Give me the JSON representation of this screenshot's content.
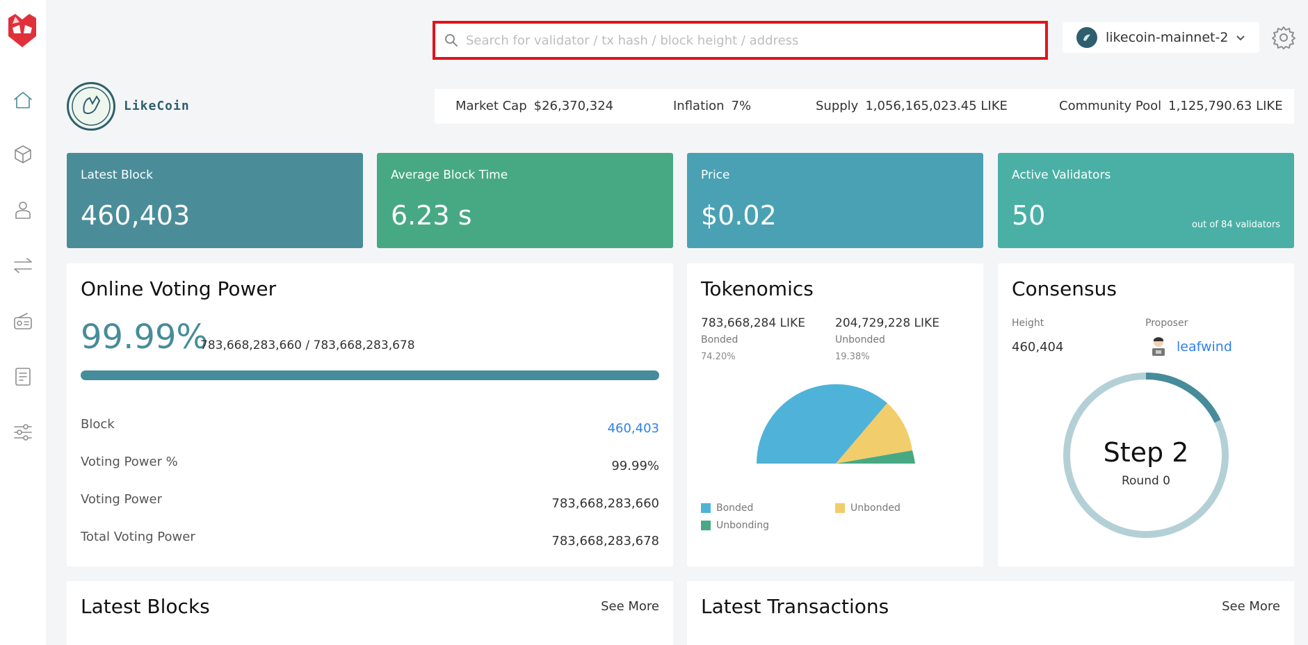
{
  "search": {
    "placeholder": "Search for validator / tx hash / block height / address"
  },
  "network": {
    "label": "likecoin-mainnet-2"
  },
  "brand": {
    "name": "LikeCoin"
  },
  "stats": {
    "market_cap_label": "Market Cap",
    "market_cap_value": "$26,370,324",
    "inflation_label": "Inflation",
    "inflation_value": "7%",
    "supply_label": "Supply",
    "supply_value": "1,056,165,023.45 LIKE",
    "pool_label": "Community Pool",
    "pool_value": "1,125,790.63 LIKE"
  },
  "cards": {
    "latest_block": {
      "title": "Latest Block",
      "value": "460,403",
      "color": "#4a8d99"
    },
    "avg_block_time": {
      "title": "Average Block Time",
      "value": "6.23 s",
      "color": "#47a983"
    },
    "price": {
      "title": "Price",
      "value": "$0.02",
      "color": "#4aa1b4"
    },
    "active_validators": {
      "title": "Active Validators",
      "value": "50",
      "sub": "out of 84 validators",
      "color": "#4ab0a6"
    }
  },
  "voting": {
    "title": "Online Voting Power",
    "percent": "99.99%",
    "fraction": "783,668,283,660 / 783,668,283,678",
    "bar_fill": 0.9999,
    "rows": [
      {
        "label": "Block",
        "value": "460,403"
      },
      {
        "label": "Voting Power %",
        "value": "99.99%"
      },
      {
        "label": "Voting Power",
        "value": "783,668,283,660"
      },
      {
        "label": "Total Voting Power",
        "value": "783,668,283,678"
      }
    ]
  },
  "tokenomics": {
    "title": "Tokenomics",
    "bonded_amount": "783,668,284 LIKE",
    "bonded_label": "Bonded",
    "bonded_pct": "74.20%",
    "unbonded_amount": "204,729,228 LIKE",
    "unbonded_label": "Unbonded",
    "unbonded_pct": "19.38%",
    "legend": [
      "Bonded",
      "Unbonded",
      "Unbonding"
    ],
    "colors": {
      "bonded": "#4fb3d9",
      "unbonded": "#f2cd6b",
      "unbonding": "#47a983"
    }
  },
  "consensus": {
    "title": "Consensus",
    "height_label": "Height",
    "height_value": "460,404",
    "proposer_label": "Proposer",
    "proposer_value": "leafwind",
    "step": "Step 2",
    "round": "Round 0"
  },
  "latest_blocks": {
    "title": "Latest Blocks",
    "see_more": "See More"
  },
  "latest_transactions": {
    "title": "Latest Transactions",
    "see_more": "See More"
  }
}
